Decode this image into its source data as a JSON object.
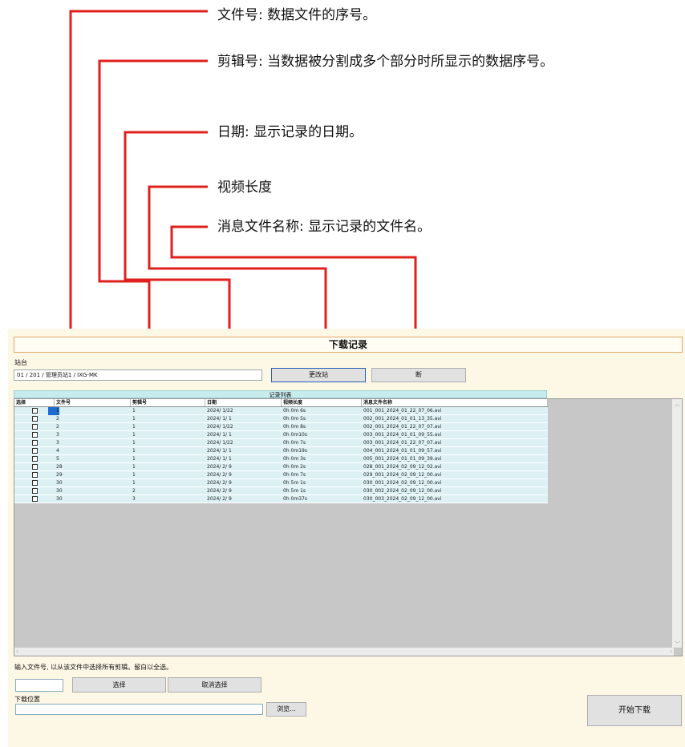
{
  "callouts": [
    {
      "text": "文件号: 数据文件的序号。"
    },
    {
      "text": "剪辑号: 当数据被分割成多个部分时所显示的数据序号。"
    },
    {
      "text": "日期: 显示记录的日期。"
    },
    {
      "text": "视频长度"
    },
    {
      "text": "消息文件名称: 显示记录的文件名。"
    }
  ],
  "window": {
    "title": "下载记录",
    "station_label": "站台",
    "station_value": "01 / 201 / 管理员站1 / IXG-MK",
    "change_station_button": "更改站",
    "disconnect_button": "断",
    "list_title": "记录列表"
  },
  "table": {
    "headers": [
      "选择",
      "文件号",
      "剪辑号",
      "日期",
      "视频长度",
      "消息文件名称"
    ],
    "rows": [
      [
        "1",
        "1",
        "2024/ 1/22",
        "0h 0m 6s",
        "001_001_2024_01_22_07_06.avi"
      ],
      [
        "2",
        "1",
        "2024/ 1/ 1",
        "0h 0m 5s",
        "002_001_2024_01_01_13_35.avi"
      ],
      [
        "2",
        "1",
        "2024/ 1/22",
        "0h 0m 8s",
        "002_001_2024_01_22_07_07.avi"
      ],
      [
        "3",
        "1",
        "2024/ 1/ 1",
        "0h 0m10s",
        "003_001_2024_01_01_09_55.avi"
      ],
      [
        "3",
        "1",
        "2024/ 1/22",
        "0h 0m 7s",
        "003_001_2024_01_22_07_07.avi"
      ],
      [
        "4",
        "1",
        "2024/ 1/ 1",
        "0h 0m19s",
        "004_001_2024_01_01_09_57.avi"
      ],
      [
        "5",
        "1",
        "2024/ 1/ 1",
        "0h 0m 3s",
        "005_001_2024_01_01_09_39.avi"
      ],
      [
        "28",
        "1",
        "2024/ 2/ 9",
        "0h 0m 2s",
        "028_001_2024_02_09_12_02.avi"
      ],
      [
        "29",
        "1",
        "2024/ 2/ 9",
        "0h 0m 7s",
        "029_001_2024_02_09_12_00.avi"
      ],
      [
        "30",
        "1",
        "2024/ 2/ 9",
        "0h 5m 1s",
        "030_001_2024_02_09_12_00.avi"
      ],
      [
        "30",
        "2",
        "2024/ 2/ 9",
        "0h 5m 1s",
        "030_002_2024_02_09_12_00.avi"
      ],
      [
        "30",
        "3",
        "2024/ 2/ 9",
        "0h 0m37s",
        "030_003_2024_02_09_12_00.avi"
      ]
    ]
  },
  "bottom": {
    "instruction": "输入文件号, 以从该文件中选择所有剪辑。留白以全选。",
    "select_button": "选择",
    "deselect_button": "取消选择",
    "download_location_label": "下载位置",
    "browse_button": "浏览...",
    "start_download_button": "开始下载"
  },
  "colors": {
    "callout_line": "#e0201c",
    "row_bg": "#ddf1f4",
    "list_title_bg": "#c8ecee",
    "window_bg": "#fdf7e6"
  }
}
